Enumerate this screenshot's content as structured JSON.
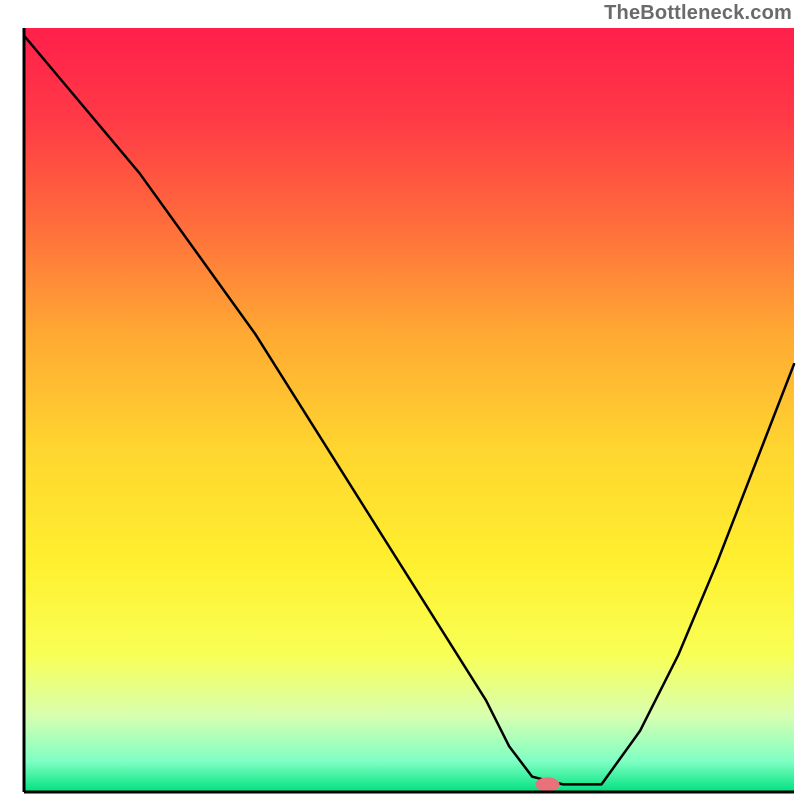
{
  "watermark": "TheBottleneck.com",
  "chart_data": {
    "type": "line",
    "title": "",
    "xlabel": "",
    "ylabel": "",
    "xlim": [
      0,
      100
    ],
    "ylim": [
      0,
      100
    ],
    "grid": false,
    "legend": false,
    "series": [
      {
        "name": "bottleneck-curve",
        "x": [
          0,
          5,
          10,
          15,
          20,
          25,
          30,
          35,
          40,
          45,
          50,
          55,
          60,
          63,
          66,
          70,
          75,
          80,
          85,
          90,
          95,
          100
        ],
        "values": [
          99,
          93,
          87,
          81,
          74,
          67,
          60,
          52,
          44,
          36,
          28,
          20,
          12,
          6,
          2,
          1,
          1,
          8,
          18,
          30,
          43,
          56
        ]
      }
    ],
    "marker": {
      "x": 68,
      "y": 1,
      "color": "#e8717a"
    },
    "gradient_stops": [
      {
        "offset": 0.0,
        "color": "#ff1f4b"
      },
      {
        "offset": 0.12,
        "color": "#ff3a46"
      },
      {
        "offset": 0.25,
        "color": "#ff6a3c"
      },
      {
        "offset": 0.4,
        "color": "#ffa933"
      },
      {
        "offset": 0.55,
        "color": "#ffd52f"
      },
      {
        "offset": 0.7,
        "color": "#fff02f"
      },
      {
        "offset": 0.82,
        "color": "#f8ff55"
      },
      {
        "offset": 0.9,
        "color": "#d8ffb0"
      },
      {
        "offset": 0.96,
        "color": "#7fffc4"
      },
      {
        "offset": 1.0,
        "color": "#00e27f"
      }
    ],
    "axis_line_color": "#000000",
    "curve_color": "#000000",
    "curve_width": 2.5,
    "marker_rx": 12,
    "marker_ry": 7
  }
}
